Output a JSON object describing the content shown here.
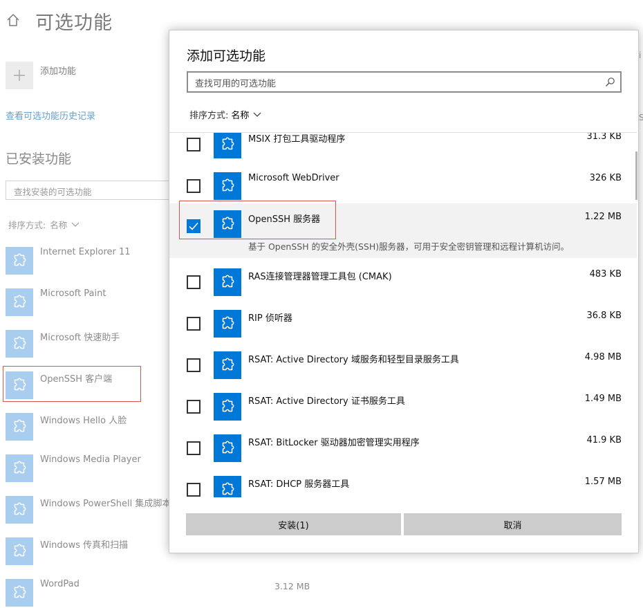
{
  "page": {
    "title": "可选功能",
    "add_feature": "添加功能",
    "history_link": "查看可选功能历史记录",
    "installed_heading": "已安装功能",
    "installed_search_placeholder": "查找安装的可选功能",
    "sort_label": "排序方式:",
    "sort_value": "名称",
    "installed_items": [
      {
        "name": "Internet Explorer 11"
      },
      {
        "name": "Microsoft Paint"
      },
      {
        "name": "Microsoft 快速助手"
      },
      {
        "name": "OpenSSH 客户端"
      },
      {
        "name": "Windows Hello 人脸"
      },
      {
        "name": "Windows Media Player"
      },
      {
        "name": "Windows PowerShell 集成脚本"
      },
      {
        "name": "Windows 传真和扫描"
      },
      {
        "name": "WordPad"
      }
    ],
    "wordpad_size": "3.12 MB",
    "right_fragment_1": "i",
    "right_fragment_2": "S"
  },
  "dialog": {
    "title": "添加可选功能",
    "search_placeholder": "查找可用的可选功能",
    "sort_label": "排序方式:",
    "sort_value": "名称",
    "items": [
      {
        "name": "MSIX 打包工具驱动程序",
        "size": "31.3 KB",
        "checked": false
      },
      {
        "name": "Microsoft WebDriver",
        "size": "326 KB",
        "checked": false
      },
      {
        "name": "OpenSSH 服务器",
        "size": "1.22 MB",
        "checked": true,
        "description": "基于 OpenSSH 的安全外壳(SSH)服务器，可用于安全密钥管理和远程计算机访问。"
      },
      {
        "name": "RAS连接管理器管理工具包 (CMAK)",
        "size": "483 KB",
        "checked": false
      },
      {
        "name": "RIP 侦听器",
        "size": "36.8 KB",
        "checked": false
      },
      {
        "name": "RSAT: Active Directory 域服务和轻型目录服务工具",
        "size": "4.98 MB",
        "checked": false
      },
      {
        "name": "RSAT: Active Directory 证书服务工具",
        "size": "1.49 MB",
        "checked": false
      },
      {
        "name": "RSAT: BitLocker 驱动器加密管理实用程序",
        "size": "41.9 KB",
        "checked": false
      },
      {
        "name": "RSAT: DHCP 服务器工具",
        "size": "1.57 MB",
        "checked": false
      }
    ],
    "install_button": "安装(1)",
    "cancel_button": "取消"
  },
  "colors": {
    "accent": "#0078d7",
    "tile_disabled": "#a9cdee",
    "highlight_box": "#d9534f"
  },
  "icons": {
    "home": "home-icon",
    "add": "plus-icon",
    "feature": "puzzle-icon",
    "search": "search-icon",
    "sort": "chevron-down-icon",
    "check": "checkmark-icon"
  }
}
